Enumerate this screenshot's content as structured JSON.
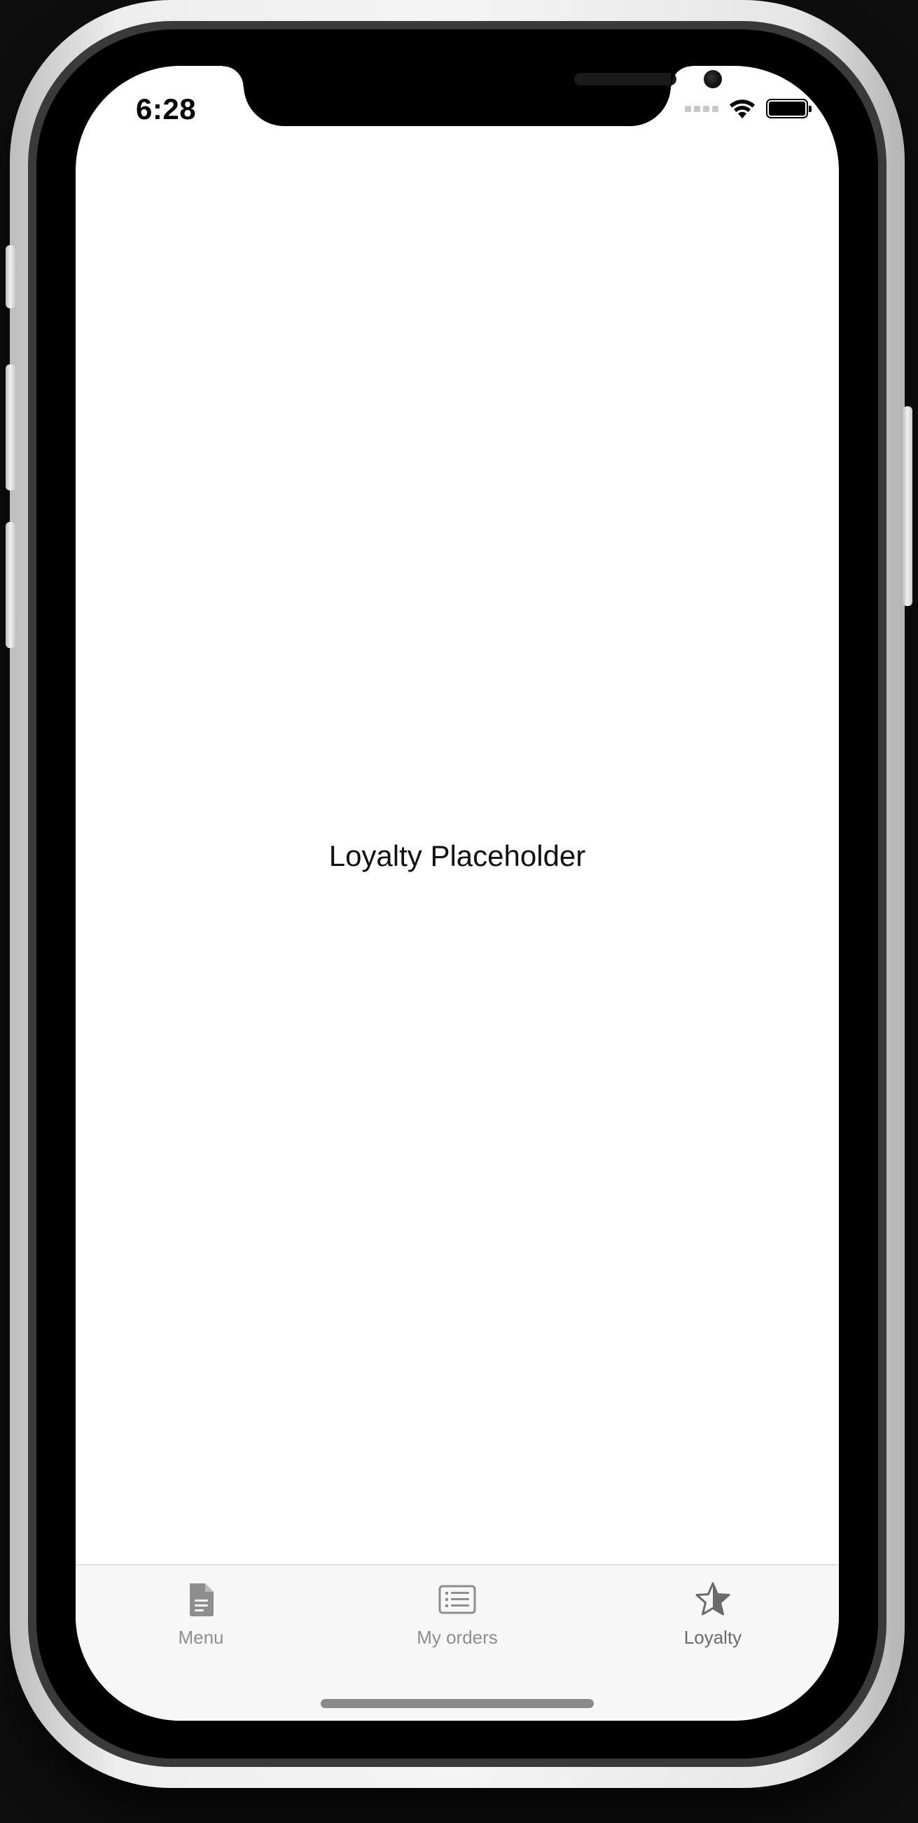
{
  "status_bar": {
    "time": "6:28",
    "icons": [
      "cellular-signal-icon",
      "wifi-icon",
      "battery-icon"
    ]
  },
  "content": {
    "placeholder_text": "Loyalty Placeholder"
  },
  "tab_bar": {
    "selected": "Loyalty",
    "items": [
      {
        "label": "Menu",
        "icon": "document-icon"
      },
      {
        "label": "My orders",
        "icon": "list-icon"
      },
      {
        "label": "Loyalty",
        "icon": "star-icon"
      }
    ]
  },
  "colors": {
    "tab_inactive": "#8e8e8e",
    "tab_active": "#6a6a6a",
    "screen_background": "#ffffff",
    "tab_bar_background": "#f7f7f7"
  }
}
